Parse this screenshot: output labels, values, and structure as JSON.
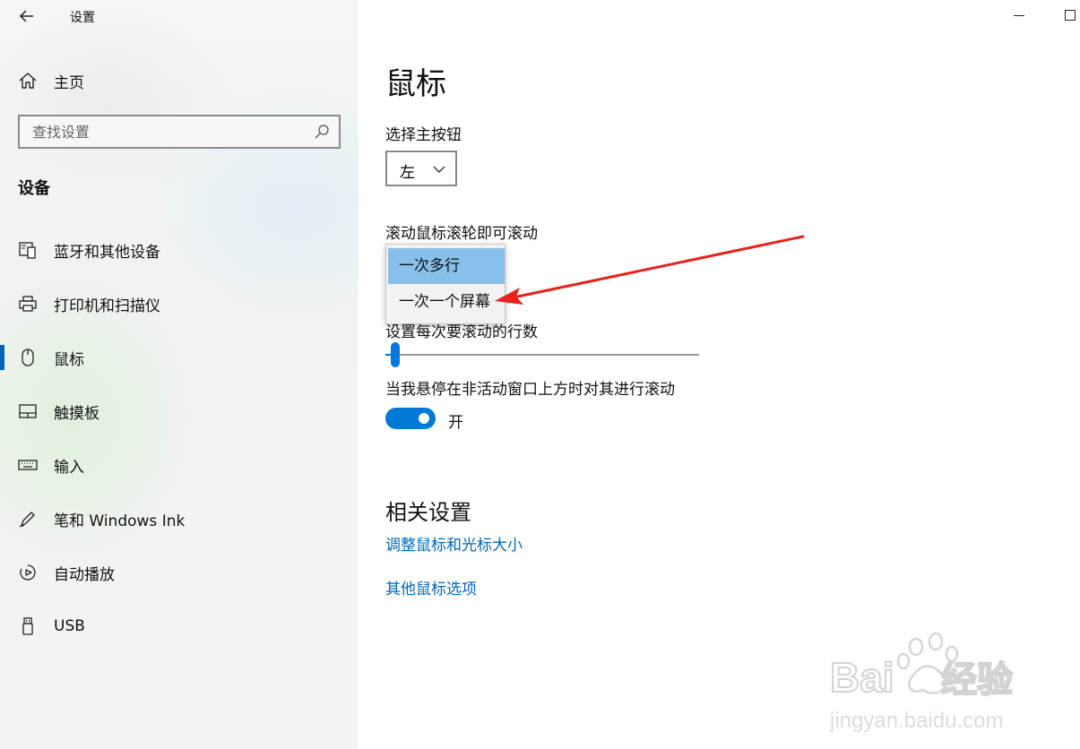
{
  "window": {
    "title": "设置",
    "back_icon": "back-arrow-icon",
    "controls": [
      "minimize-icon",
      "maximize-icon"
    ]
  },
  "sidebar": {
    "home_label": "主页",
    "search_placeholder": "查找设置",
    "section_title": "设备",
    "items": [
      {
        "label": "蓝牙和其他设备",
        "icon": "bluetooth-devices-icon",
        "selected": false
      },
      {
        "label": "打印机和扫描仪",
        "icon": "printer-icon",
        "selected": false
      },
      {
        "label": "鼠标",
        "icon": "mouse-icon",
        "selected": true
      },
      {
        "label": "触摸板",
        "icon": "touchpad-icon",
        "selected": false
      },
      {
        "label": "输入",
        "icon": "keyboard-icon",
        "selected": false
      },
      {
        "label": "笔和 Windows Ink",
        "icon": "pen-icon",
        "selected": false
      },
      {
        "label": "自动播放",
        "icon": "autoplay-icon",
        "selected": false
      },
      {
        "label": "USB",
        "icon": "usb-icon",
        "selected": false
      }
    ]
  },
  "main": {
    "title": "鼠标",
    "primary_button_label": "选择主按钮",
    "primary_button_value": "左",
    "scroll_label": "滚动鼠标滚轮即可滚动",
    "scroll_options": [
      "一次多行",
      "一次一个屏幕"
    ],
    "scroll_selected": "一次多行",
    "lines_label": "设置每次要滚动的行数",
    "lines_slider_fraction": 0.03,
    "hover_label": "当我悬停在非活动窗口上方时对其进行滚动",
    "hover_toggle_state": "开",
    "related_title": "相关设置",
    "links": [
      "调整鼠标和光标大小",
      "其他鼠标选项"
    ]
  },
  "colors": {
    "accent": "#0078d7",
    "link": "#0067b8",
    "dropdown_selected": "#88c0eb",
    "annotation_arrow": "#e8211c"
  },
  "watermark": {
    "brand": "Baidu",
    "brand_cn": "经验",
    "url": "jingyan.baidu.com"
  }
}
